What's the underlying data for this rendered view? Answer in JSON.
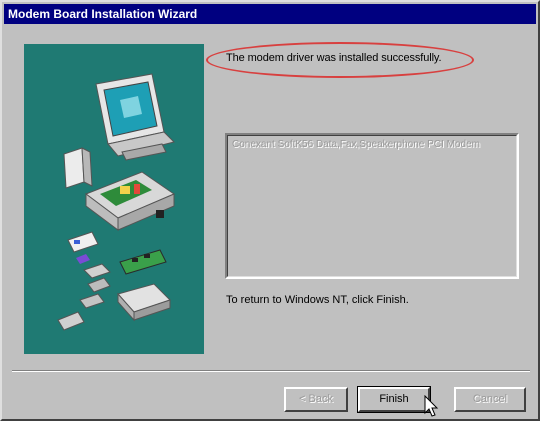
{
  "window": {
    "title": "Modem Board Installation Wizard"
  },
  "status": {
    "message": "The modem driver was installed successfully."
  },
  "device_list": {
    "items": [
      "Conexant SoftK56 Data,Fax,Speakerphone PCI Modem"
    ]
  },
  "instructions": {
    "return_text": "To return to Windows NT, click Finish."
  },
  "buttons": {
    "back_label": "< Back",
    "finish_label": "Finish",
    "cancel_label": "Cancel"
  },
  "colors": {
    "titlebar": "#000080",
    "art_panel": "#1f7a73",
    "highlight_oval": "#d8403f",
    "face": "#c0c0c0"
  },
  "icons": {
    "cursor": "arrow-cursor-icon",
    "illustration": "computer-hardware-illustration"
  }
}
